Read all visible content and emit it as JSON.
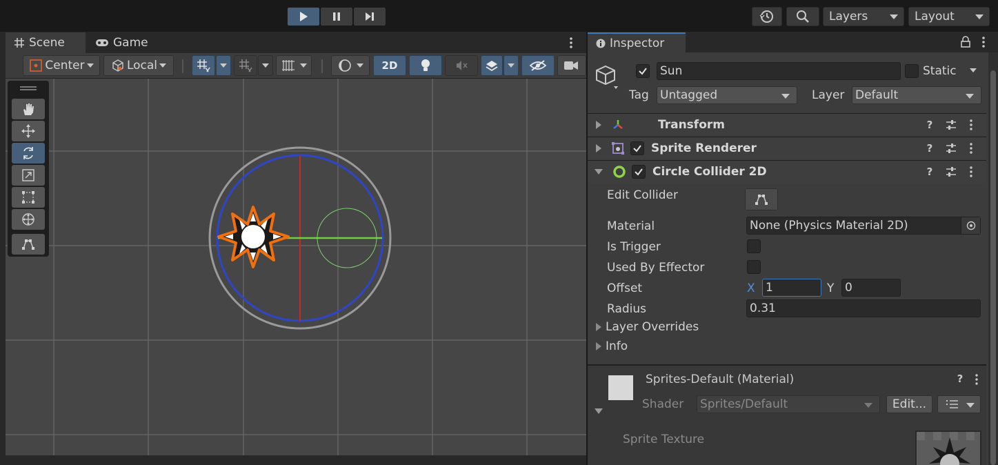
{
  "toolbar": {
    "layers_label": "Layers",
    "layout_label": "Layout"
  },
  "scene_panel": {
    "tabs": [
      {
        "label": "Scene",
        "active": true
      },
      {
        "label": "Game",
        "active": false
      }
    ],
    "pivot_mode": "Center",
    "pivot_rotation": "Local",
    "view_2d_label": "2D"
  },
  "inspector": {
    "tab_label": "Inspector",
    "object_name": "Sun",
    "object_active": true,
    "static_label": "Static",
    "static_checked": false,
    "tag_label": "Tag",
    "tag_value": "Untagged",
    "layer_label": "Layer",
    "layer_value": "Default",
    "components": [
      {
        "title": "Transform",
        "expanded": false,
        "has_toggle": false,
        "icon": "transform-icon"
      },
      {
        "title": "Sprite Renderer",
        "expanded": false,
        "has_toggle": true,
        "enabled": true,
        "icon": "sprite-renderer-icon"
      },
      {
        "title": "Circle Collider 2D",
        "expanded": true,
        "has_toggle": true,
        "enabled": true,
        "icon": "circle-collider-icon"
      }
    ],
    "collider": {
      "edit_collider_label": "Edit Collider",
      "material_label": "Material",
      "material_value": "None (Physics Material 2D)",
      "is_trigger_label": "Is Trigger",
      "is_trigger": false,
      "used_by_effector_label": "Used By Effector",
      "used_by_effector": false,
      "offset_label": "Offset",
      "offset_x_label": "X",
      "offset_x": "1",
      "offset_y_label": "Y",
      "offset_y": "0",
      "radius_label": "Radius",
      "radius": "0.31",
      "layer_overrides_label": "Layer Overrides",
      "info_label": "Info"
    },
    "material": {
      "name": "Sprites-Default (Material)",
      "shader_label": "Shader",
      "shader_value": "Sprites/Default",
      "edit_label": "Edit...",
      "sprite_texture_label": "Sprite Texture"
    }
  },
  "colors": {
    "accent_blue": "#46607c",
    "circle_outer": "#9a9a9a",
    "circle_inner": "#2f45c8",
    "axis_red": "#c8282a",
    "axis_green": "#6ed23c",
    "collider_green": "#7ad26a",
    "sun_orange": "#f07010"
  }
}
